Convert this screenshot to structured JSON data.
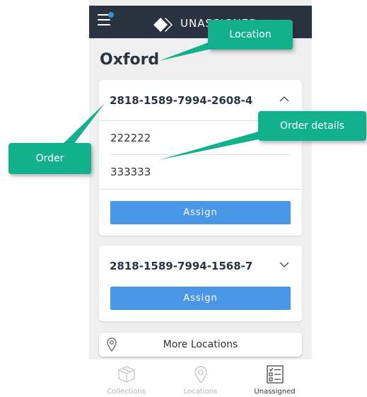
{
  "app": {
    "header_title": "UNASSIGNED",
    "location_name": "Oxford"
  },
  "orders": [
    {
      "number": "2818-1589-7994-2608-4",
      "expanded": true,
      "chevron_icon": "chevron-up-icon",
      "details": [
        "222222",
        "333333"
      ],
      "assign_label": "Assign"
    },
    {
      "number": "2818-1589-7994-1568-7",
      "expanded": false,
      "chevron_icon": "chevron-down-icon",
      "details": [],
      "assign_label": "Assign"
    }
  ],
  "more_locations": {
    "label": "More Locations",
    "icon": "location-pin-icon"
  },
  "bottom_nav": [
    {
      "label": "Collections",
      "icon": "box-icon",
      "active": false
    },
    {
      "label": "Locations",
      "icon": "location-pin-icon",
      "active": false
    },
    {
      "label": "Unassigned",
      "icon": "checklist-icon",
      "active": true
    }
  ],
  "annotations": {
    "location": "Location",
    "order_details": "Order details",
    "order": "Order"
  },
  "colors": {
    "header_bg": "#2b3340",
    "assign_button": "#4a97e6",
    "callout_bg": "#13b08c",
    "notification_dot": "#2f8fe0"
  }
}
